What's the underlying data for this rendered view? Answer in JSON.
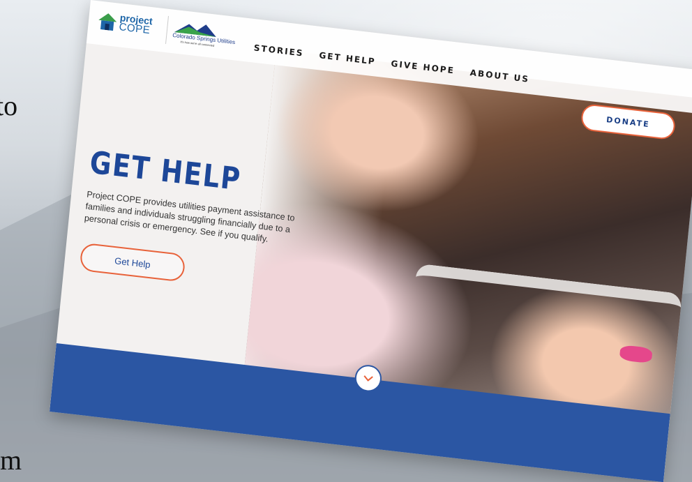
{
  "slide": {
    "text_top": "to",
    "text_bottom": "m"
  },
  "site": {
    "logo_primary": {
      "line1": "project",
      "line2": "COPE"
    },
    "logo_partner": {
      "name": "Colorado Springs Utilities",
      "tagline": "It's how we're all connected"
    },
    "nav": [
      "STORIES",
      "GET HELP",
      "GIVE HOPE",
      "ABOUT US"
    ],
    "donate_label": "DONATE",
    "hero": {
      "title": "GET HELP",
      "description": "Project COPE provides utilities payment assistance to families and individuals struggling financially due to a personal crisis or emergency. See if you qualify.",
      "button_label": "Get Help"
    }
  },
  "colors": {
    "brand_blue": "#1d4798",
    "accent_orange": "#e8623a",
    "footer_blue": "#2b56a3"
  }
}
